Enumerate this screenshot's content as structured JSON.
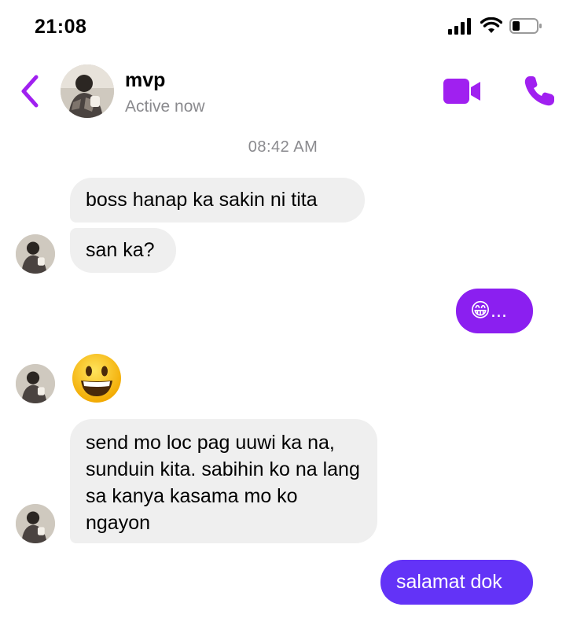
{
  "status_bar": {
    "time": "21:08",
    "icons": [
      "signal-icon",
      "wifi-icon",
      "battery-icon"
    ]
  },
  "header": {
    "back_icon": "chevron-left-icon",
    "contact_name": "mvp",
    "contact_status": "Active now",
    "actions": [
      "video-call-icon",
      "phone-call-icon"
    ]
  },
  "conversation": {
    "timestamp": "08:42 AM",
    "messages": [
      {
        "from": "them",
        "text": "boss hanap ka sakin ni tita"
      },
      {
        "from": "them",
        "text": "san ka?"
      },
      {
        "from": "me",
        "text": "😁..."
      },
      {
        "from": "them",
        "emoji": "grinning-face-icon"
      },
      {
        "from": "them",
        "text": "send mo loc pag uuwi ka na, sunduin kita. sabihin ko na lang sa kanya kasama mo ko ngayon"
      },
      {
        "from": "me",
        "text": "salamat dok"
      }
    ]
  },
  "colors": {
    "accent": "#a020f0",
    "outgoing_bubble_1": "#8b1ff0",
    "outgoing_bubble_2": "#6333f7",
    "incoming_bubble": "#efefef",
    "muted_text": "#8a8a8e"
  }
}
